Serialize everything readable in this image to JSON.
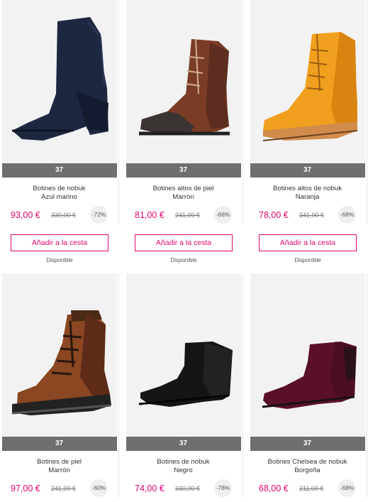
{
  "products": [
    {
      "size": "37",
      "name": "Botines de nobuk",
      "color": "Azul marino",
      "price": "93,00 €",
      "old_price": "330,00 €",
      "discount": "-72%",
      "cart_label": "Añadir a la cesta",
      "availability": "Disponible",
      "icon": "navy-sock-boot-image"
    },
    {
      "size": "37",
      "name": "Botines altos de piel",
      "color": "Marrón",
      "price": "81,00 €",
      "old_price": "241,00 €",
      "discount": "-66%",
      "cart_label": "Añadir a la cesta",
      "availability": "Disponible",
      "icon": "brown-lace-boot-image"
    },
    {
      "size": "37",
      "name": "Botines altos de nobuk",
      "color": "Naranja",
      "price": "78,00 €",
      "old_price": "241,00 €",
      "discount": "-68%",
      "cart_label": "Añadir a la cesta",
      "availability": "Disponible",
      "icon": "yellow-nubuck-boot-image"
    },
    {
      "size": "37",
      "name": "Botines de piel",
      "color": "Marrón",
      "price": "97,00 €",
      "old_price": "241,00 €",
      "discount": "-60%",
      "icon": "brown-fur-boot-image"
    },
    {
      "size": "37",
      "name": "Botines de nobuk",
      "color": "Negro",
      "price": "74,00 €",
      "old_price": "330,00 €",
      "discount": "-78%",
      "icon": "black-ankle-boot-image"
    },
    {
      "size": "37",
      "name": "Botines Chelsea de nobuk",
      "color": "Borgoña",
      "price": "68,00 €",
      "old_price": "211,00 €",
      "discount": "-68%",
      "icon": "burgundy-chelsea-boot-image"
    }
  ],
  "colors": {
    "accent": "#e0066f",
    "size_bar": "#6f6f6f",
    "image_bg": "#f2f2f2",
    "discount_bg": "#efefef"
  }
}
